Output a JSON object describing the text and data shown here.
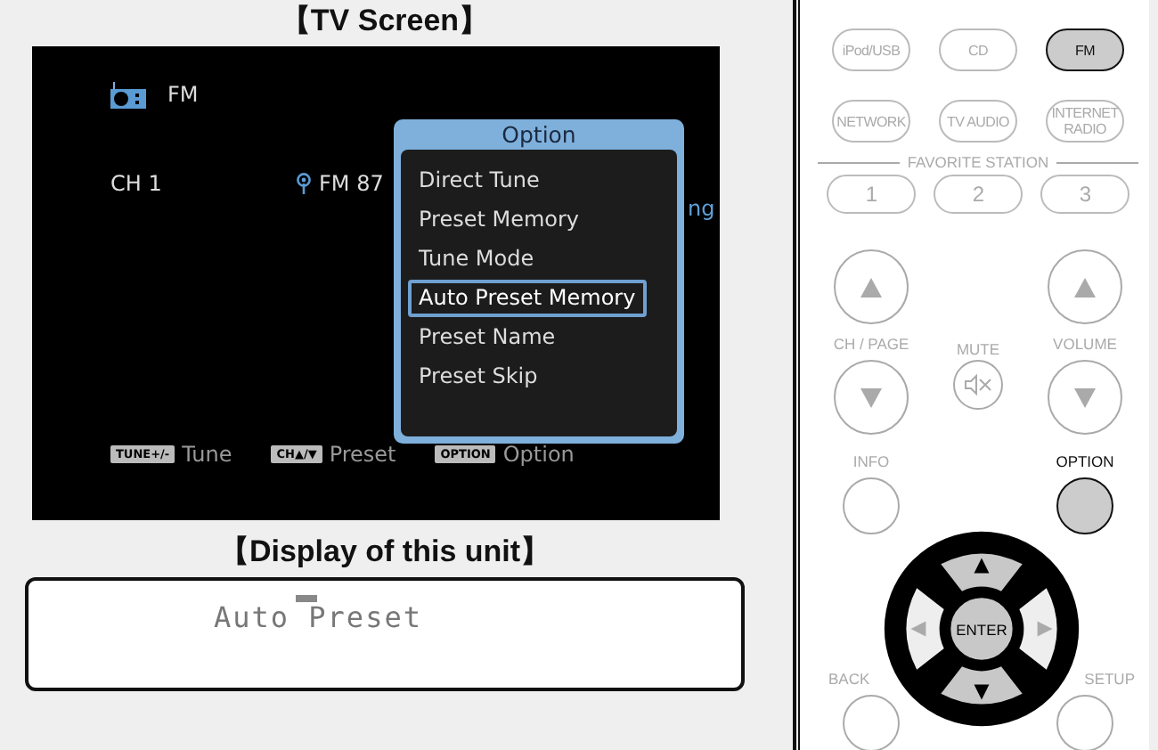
{
  "tv_screen": {
    "title": "【TV Screen】",
    "source": "FM",
    "channel": "CH 1",
    "frequency": "FM 87",
    "cut_text": "ng",
    "option_menu": {
      "title": "Option",
      "items": [
        {
          "label": "Direct Tune",
          "selected": false
        },
        {
          "label": "Preset Memory",
          "selected": false
        },
        {
          "label": "Tune Mode",
          "selected": false
        },
        {
          "label": "Auto Preset Memory",
          "selected": true
        },
        {
          "label": "Preset Name",
          "selected": false
        },
        {
          "label": "Preset Skip",
          "selected": false
        }
      ]
    },
    "hints": [
      {
        "key": "TUNE+/-",
        "label": "Tune"
      },
      {
        "key": "CH▲/▼",
        "label": "Preset"
      },
      {
        "key": "OPTION",
        "label": "Option"
      }
    ]
  },
  "unit_display": {
    "title": "【Display of this unit】",
    "text": "Auto Preset"
  },
  "remote": {
    "source_buttons": [
      {
        "label": "iPod/USB",
        "highlighted": false
      },
      {
        "label": "CD",
        "highlighted": false
      },
      {
        "label": "FM",
        "highlighted": true
      },
      {
        "label": "NETWORK",
        "highlighted": false
      },
      {
        "label": "TV AUDIO",
        "highlighted": false
      },
      {
        "label": "INTERNET RADIO",
        "highlighted": false
      }
    ],
    "favorite_label": "FAVORITE STATION",
    "favorite_buttons": [
      "1",
      "2",
      "3"
    ],
    "ch_label": "CH / PAGE",
    "mute_label": "MUTE",
    "volume_label": "VOLUME",
    "info_label": "INFO",
    "option_label": "OPTION",
    "option_highlighted": true,
    "enter_label": "ENTER",
    "dpad_highlighted": true,
    "back_label": "BACK",
    "setup_label": "SETUP"
  }
}
